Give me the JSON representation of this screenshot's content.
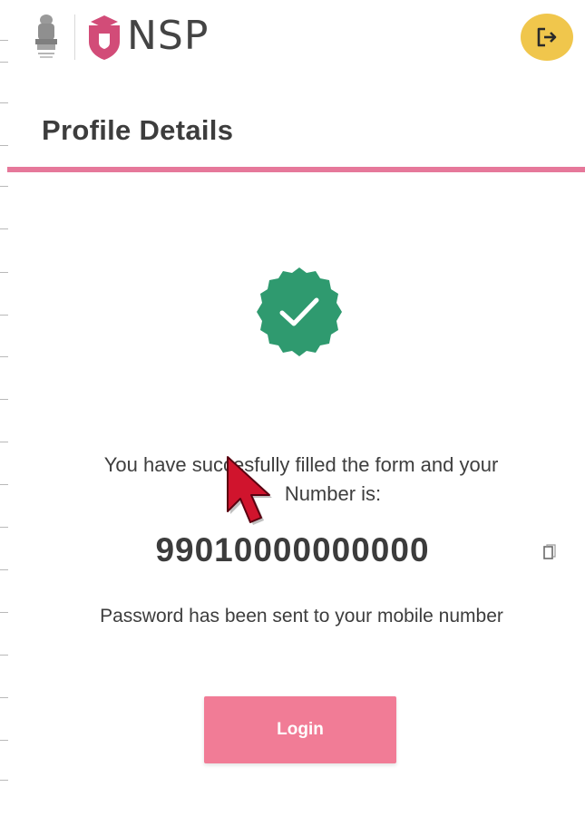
{
  "header": {
    "brand_text": "NSP",
    "icons": {
      "emblem": "india-emblem-icon",
      "shield": "nsp-shield-icon",
      "logout": "logout-icon"
    }
  },
  "page": {
    "title": "Profile Details"
  },
  "success": {
    "icon": "success-check-icon",
    "message_part1": "You have succe",
    "message_part2": "sfully filled the form and your",
    "message_part3": "Number is:",
    "nsp_number": "99010000000000",
    "copy_icon": "copy-icon",
    "password_note": "Password has been sent to your mobile number"
  },
  "actions": {
    "login_label": "Login"
  },
  "colors": {
    "accent_pink": "#e6789a",
    "login_button": "#f17c96",
    "logout_button": "#f0c64c",
    "success_green": "#2f9a6f",
    "cursor_red": "#d0142d"
  }
}
